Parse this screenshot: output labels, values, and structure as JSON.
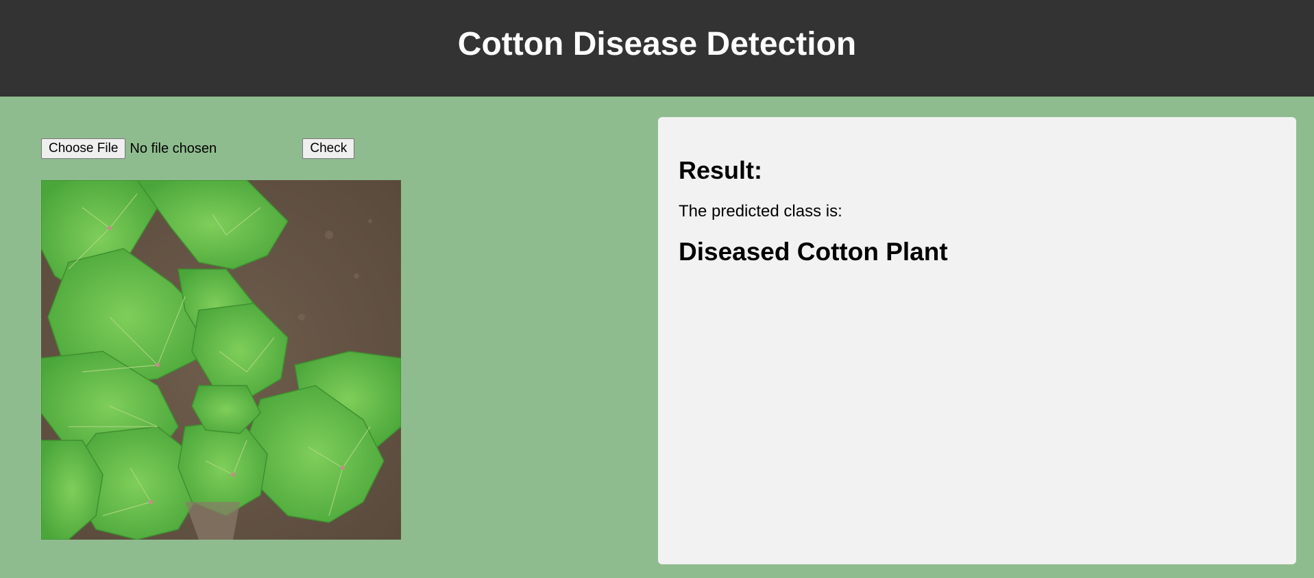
{
  "header": {
    "title": "Cotton Disease Detection"
  },
  "upload": {
    "choose_file_label": "Choose File",
    "file_status": "No file chosen",
    "check_label": "Check"
  },
  "preview": {
    "image_subject": "cotton plant seedling leaves on soil"
  },
  "result": {
    "heading": "Result:",
    "label": "The predicted class is:",
    "predicted_class": "Diseased Cotton Plant"
  },
  "colors": {
    "header_bg": "#333333",
    "page_bg": "#8fbc8f",
    "panel_bg": "#f2f2f2"
  }
}
